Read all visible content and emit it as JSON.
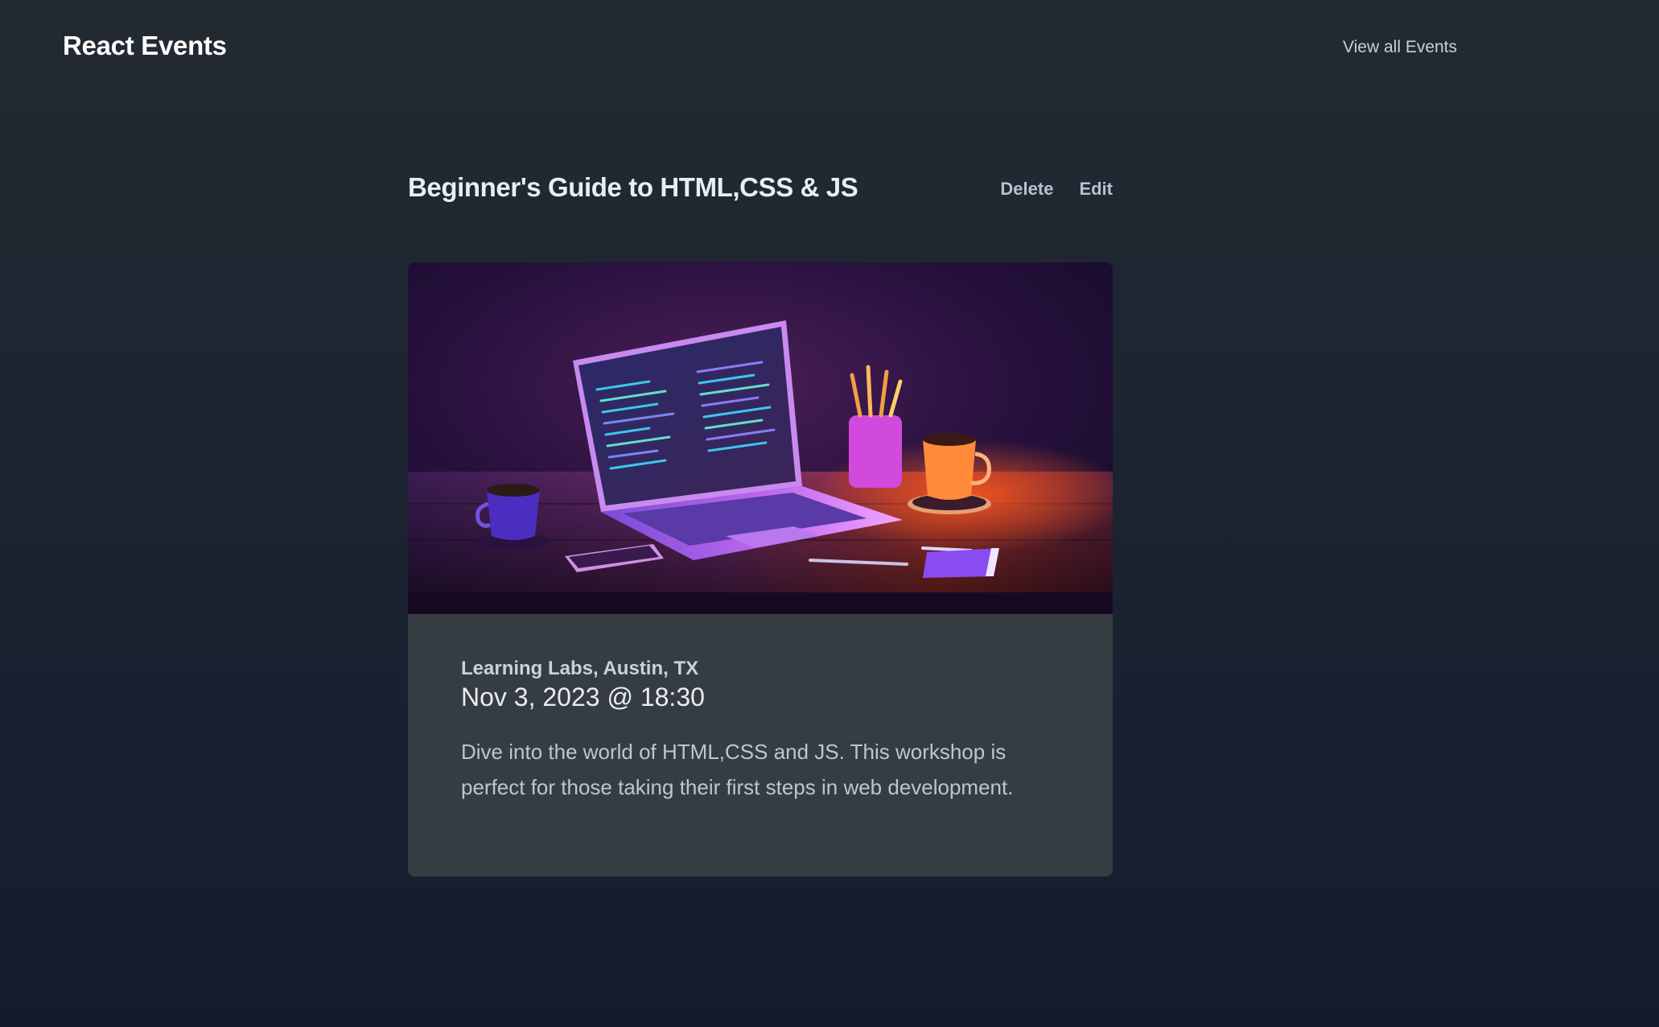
{
  "navbar": {
    "brand": "React Events",
    "view_all_link": "View all Events"
  },
  "event": {
    "title": "Beginner's Guide to HTML,CSS & JS",
    "actions": {
      "delete_label": "Delete",
      "edit_label": "Edit"
    },
    "image_alt": "Illustration of a laptop with code on a desk with coffee cups and a pencil jar under purple and orange light",
    "venue": "Learning Labs, Austin, TX",
    "datetime": "Nov 3, 2023 @ 18:30",
    "description": "Dive into the world of HTML,CSS and JS. This workshop is perfect for those taking their first steps in web development."
  },
  "colors": {
    "page_bg_top": "#232a31",
    "page_bg_bottom": "#131c2e",
    "card_bg": "#363d42",
    "accent_purple": "#b85cff",
    "accent_orange": "#ff6a2a"
  }
}
